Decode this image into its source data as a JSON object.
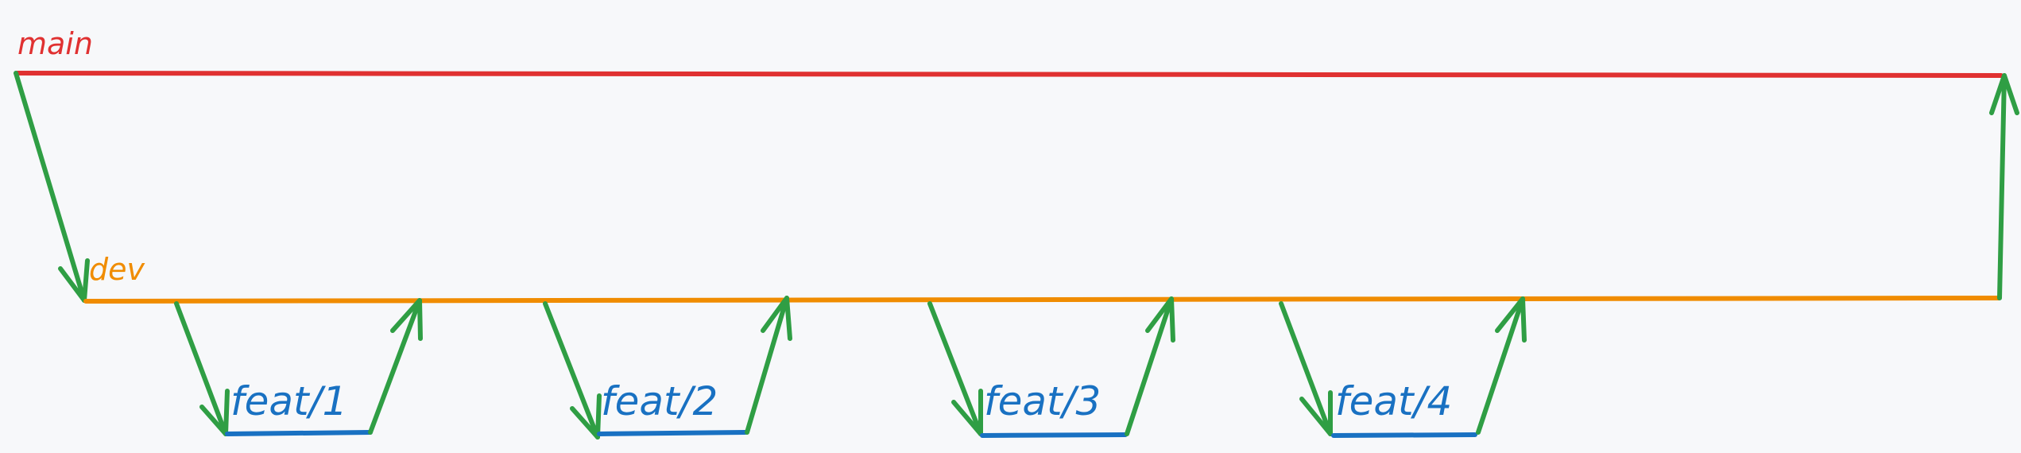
{
  "diagram": {
    "labels": {
      "main": "main",
      "dev": "dev",
      "features": [
        "feat/1",
        "feat/2",
        "feat/3",
        "feat/4"
      ]
    },
    "colors": {
      "background": "#f7f8fa",
      "main": "#e03131",
      "dev": "#f08c00",
      "feature": "#1971c2",
      "arrow": "#2f9e44"
    }
  }
}
